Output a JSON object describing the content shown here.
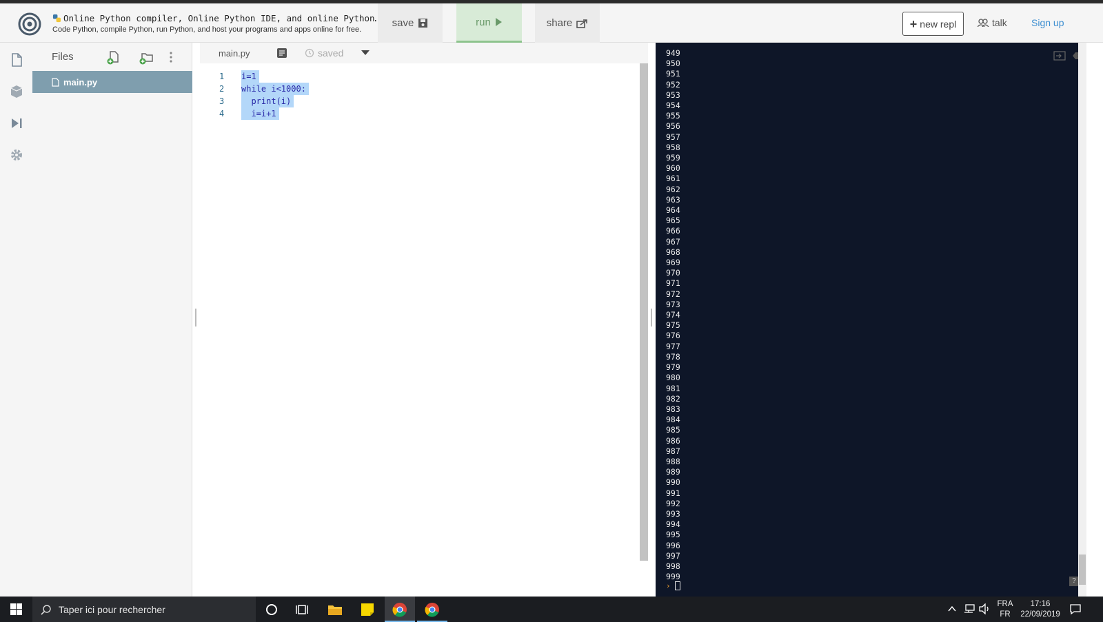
{
  "header": {
    "project_title": "Online Python compiler, Online Python IDE, and online Python…",
    "project_description": "Code Python, compile Python, run Python, and host your programs and apps online for free.",
    "save_label": "save",
    "run_label": "run",
    "share_label": "share",
    "new_repl_label": "new repl",
    "talk_label": "talk",
    "signup_label": "Sign up"
  },
  "files": {
    "title": "Files",
    "items": [
      {
        "label": "main.py"
      }
    ]
  },
  "editor": {
    "tab_label": "main.py",
    "saved_label": "saved",
    "lines": [
      {
        "num": "1",
        "code": "i=1"
      },
      {
        "num": "2",
        "code": "while i<1000:"
      },
      {
        "num": "3",
        "code": "  print(i)"
      },
      {
        "num": "4",
        "code": "  i=i+1"
      }
    ]
  },
  "console": {
    "first_output": 949,
    "last_output": 999,
    "help_label": "?"
  },
  "taskbar": {
    "search_placeholder": "Taper ici pour rechercher",
    "lang_top": "FRA",
    "lang_bottom": "FR",
    "time": "17:16",
    "date": "22/09/2019"
  },
  "colors": {
    "run_bg": "#d8ebd7",
    "console_bg": "#0e1628",
    "selected_file": "#7f9eae",
    "selection": "#b3d7f9",
    "link": "#3d8fd1"
  }
}
